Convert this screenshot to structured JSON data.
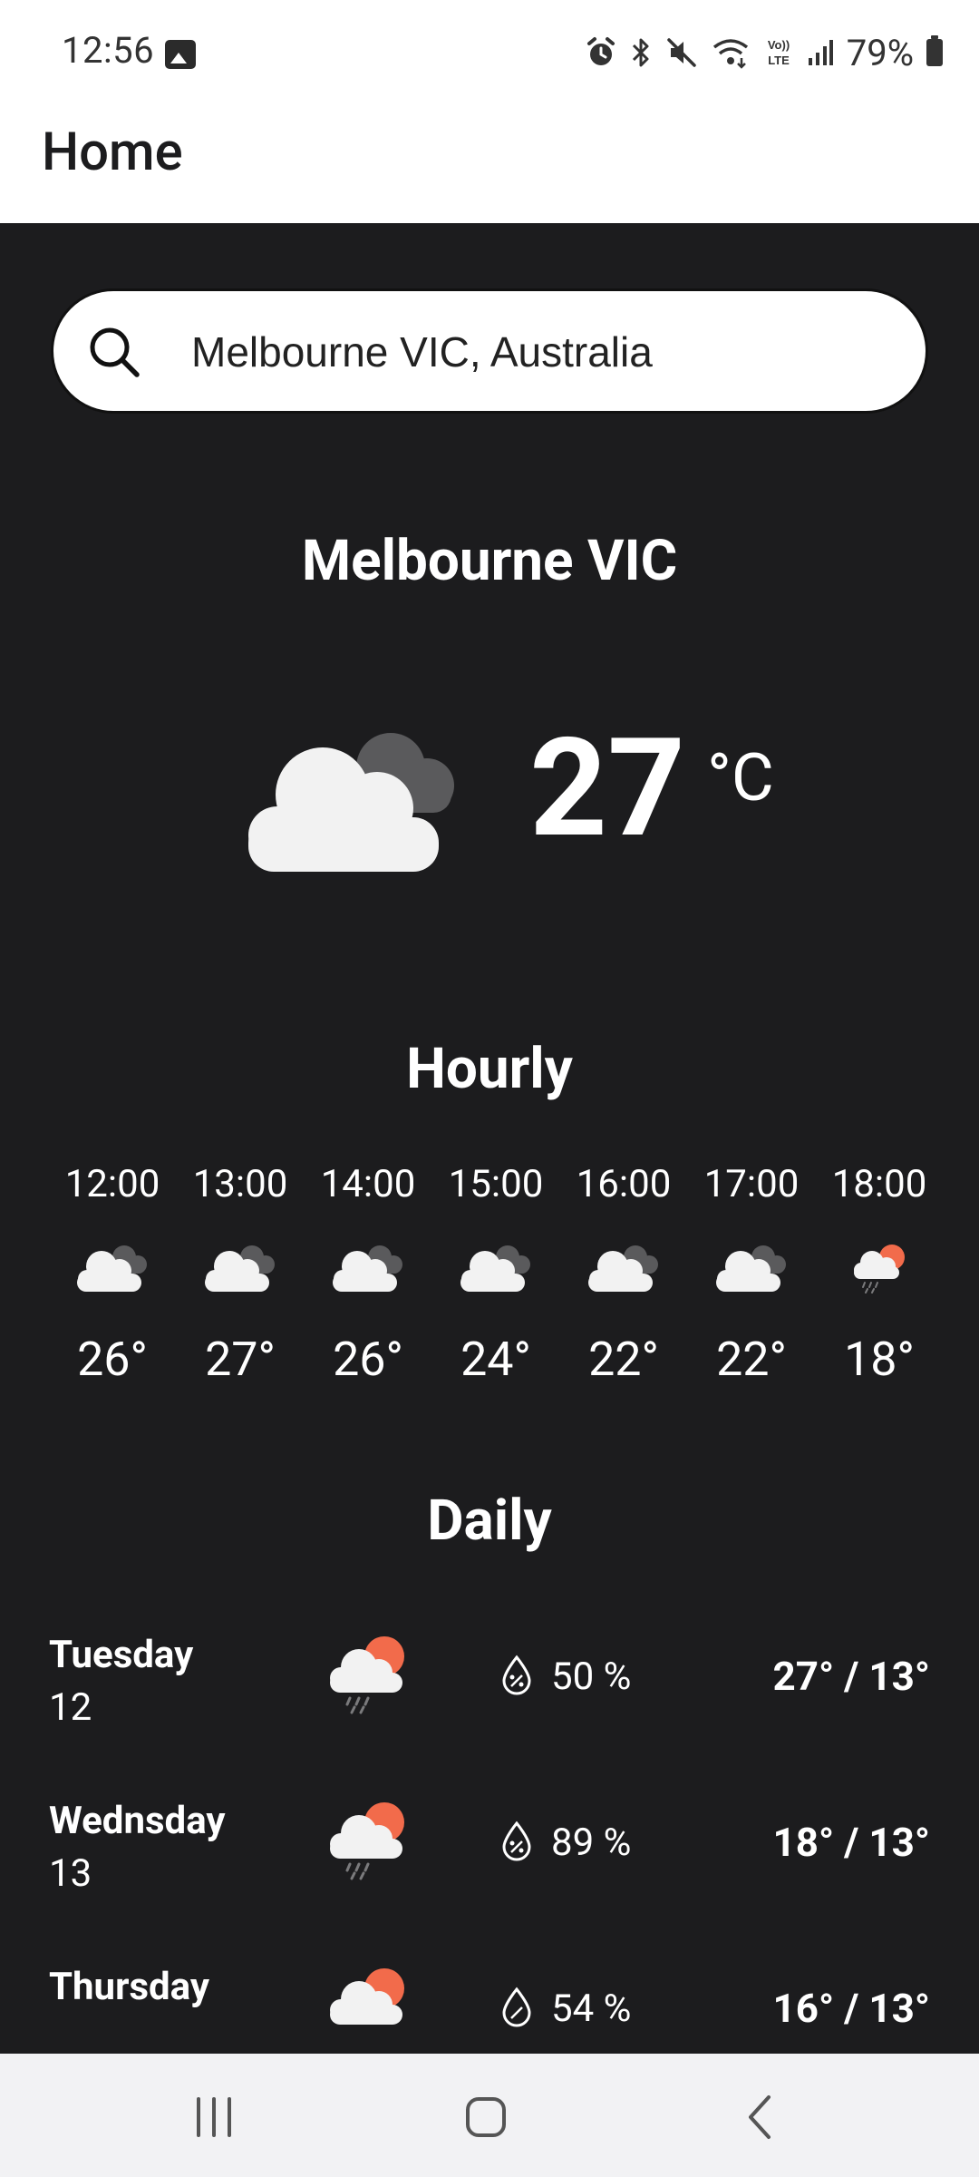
{
  "status_bar": {
    "time": "12:56",
    "battery": "79%",
    "icons": [
      "gallery-icon",
      "alarm-icon",
      "bluetooth-icon",
      "mute-icon",
      "wifi-icon",
      "volte-icon",
      "signal-icon",
      "battery-icon"
    ]
  },
  "app_bar": {
    "title": "Home"
  },
  "search": {
    "value": "Melbourne VIC, Australia",
    "icon": "search-icon"
  },
  "current": {
    "city": "Melbourne VIC",
    "temp": "27",
    "unit": "°C",
    "icon": "cloudy-icon"
  },
  "hourly": {
    "title": "Hourly",
    "items": [
      {
        "time": "12:00",
        "temp": "26°",
        "icon": "cloudy-icon"
      },
      {
        "time": "13:00",
        "temp": "27°",
        "icon": "cloudy-icon"
      },
      {
        "time": "14:00",
        "temp": "26°",
        "icon": "cloudy-icon"
      },
      {
        "time": "15:00",
        "temp": "24°",
        "icon": "cloudy-icon"
      },
      {
        "time": "16:00",
        "temp": "22°",
        "icon": "cloudy-icon"
      },
      {
        "time": "17:00",
        "temp": "22°",
        "icon": "cloudy-icon"
      },
      {
        "time": "18:00",
        "temp": "18°",
        "icon": "sun-rain-icon"
      }
    ]
  },
  "daily": {
    "title": "Daily",
    "items": [
      {
        "day": "Tuesday",
        "date": "12",
        "rain": "50 %",
        "temps": "27° / 13°",
        "icon": "sun-rain-icon"
      },
      {
        "day": "Wednsday",
        "date": "13",
        "rain": "89 %",
        "temps": "18° / 13°",
        "icon": "sun-rain-icon"
      },
      {
        "day": "Thursday",
        "date": "",
        "rain": "54 %",
        "temps": "16° / 13°",
        "icon": "sun-rain-icon"
      }
    ]
  },
  "colors": {
    "background": "#1c1c1e",
    "sun": "#f26b4b",
    "cloud": "#f2f2f2",
    "cloud_dark": "#5a5a5c"
  }
}
